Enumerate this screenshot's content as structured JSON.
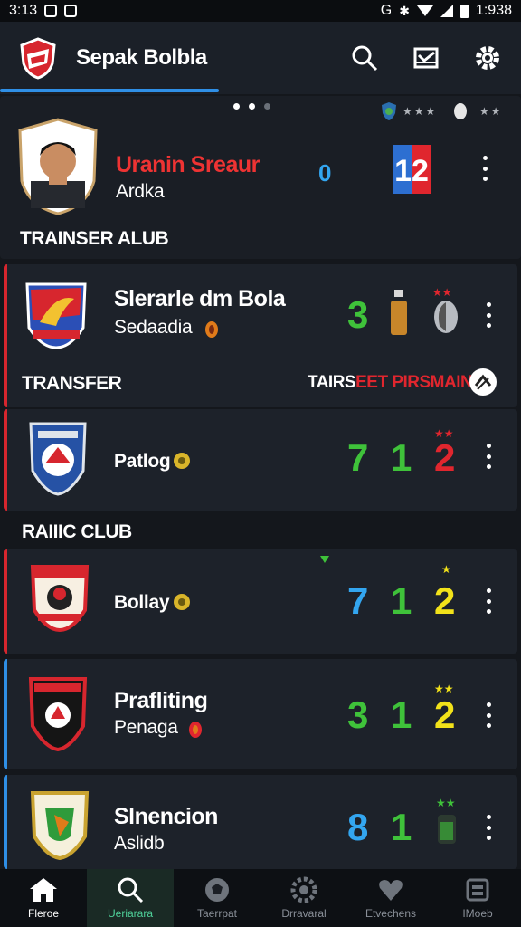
{
  "status_bar": {
    "time_left": "3:13",
    "time_right": "1:938",
    "carrier_letter": "G"
  },
  "app_bar": {
    "title": "Sepak Bolbla"
  },
  "featured": {
    "name_part1": "Uranin",
    "name_part2": "Sreaur",
    "subtitle": "Ardka",
    "score": "0",
    "footer_label": "TRAINSER ALUB"
  },
  "cards": [
    {
      "name": "Slerarle dm Bola",
      "subtitle": "Sedaadia",
      "score": "3",
      "label_left": "TRANSFER",
      "label_right_a": "TAIRS",
      "label_right_b": "EET PIRSMAIN"
    },
    {
      "name": "Patlog",
      "scores": [
        "7",
        "1",
        "2"
      ],
      "section_after": "RAIIIC CLUB"
    },
    {
      "name": "Bollay",
      "scores": [
        "7",
        "1",
        "2"
      ]
    },
    {
      "name": "Prafliting",
      "subtitle": "Penaga",
      "scores": [
        "3",
        "1",
        "2"
      ]
    },
    {
      "name": "Slnencion",
      "subtitle": "Aslidb",
      "scores": [
        "8",
        "1"
      ]
    }
  ],
  "colors": {
    "green": "#3fc23a",
    "blue": "#33a6f0",
    "red": "#e0262e",
    "yellow": "#f2e21a",
    "accent": "#2f8fe6"
  },
  "bottom_nav": [
    "Fleroe",
    "Ueriarara",
    "Taerrpat",
    "Drravaral",
    "Etvechens",
    "IMoeb"
  ]
}
